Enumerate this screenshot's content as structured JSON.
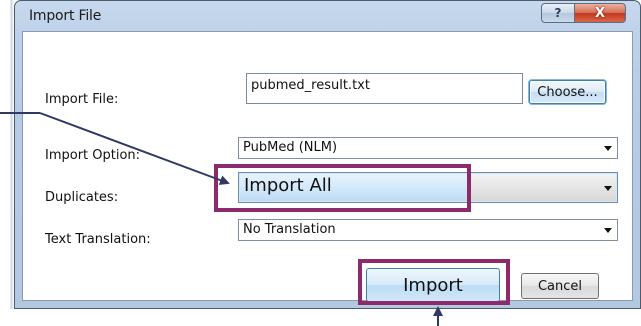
{
  "window": {
    "title": "Import File",
    "help_glyph": "?",
    "close_glyph": "X"
  },
  "form": {
    "import_file": {
      "label": "Import File:",
      "value": "pubmed_result.txt",
      "choose_label": "Choose..."
    },
    "import_option": {
      "label": "Import Option:",
      "value": "PubMed (NLM)"
    },
    "duplicates": {
      "label": "Duplicates:",
      "value": "Import All"
    },
    "text_translation": {
      "label": "Text Translation:",
      "value": "No Translation"
    }
  },
  "buttons": {
    "import_label": "Import",
    "cancel_label": "Cancel"
  },
  "annotation": {
    "color": "#8c2a6b",
    "arrow_color": "#2e3a63"
  },
  "icons": [
    "help-icon",
    "close-icon",
    "dropdown-arrow-icon"
  ]
}
